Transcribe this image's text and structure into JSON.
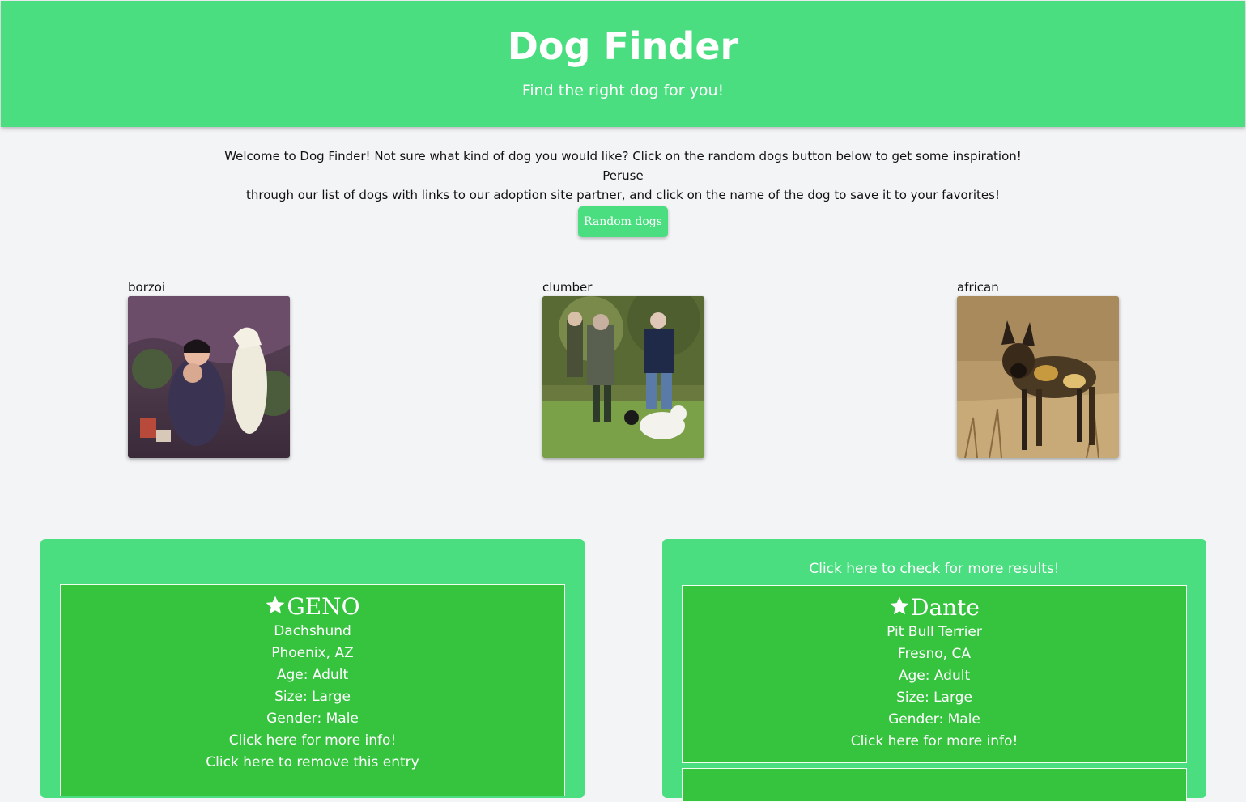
{
  "header": {
    "title": "Dog Finder",
    "subtitle": "Find the right dog for you!"
  },
  "intro": {
    "line1": "Welcome to Dog Finder! Not sure what kind of dog you would like? Click on the random dogs button below to get some inspiration! Peruse",
    "line2": "through our list of dogs with links to our adoption site partner, and click on the name of the dog to save it to your favorites!"
  },
  "random_button": {
    "label": "Random dogs"
  },
  "random_dogs": [
    {
      "breed": "borzoi"
    },
    {
      "breed": "clumber"
    },
    {
      "breed": "african"
    }
  ],
  "results_panel": {
    "more_results_link": "Click here to check for more results!"
  },
  "favorites": [
    {
      "name": "GENO",
      "breed": "Dachshund",
      "location": "Phoenix, AZ",
      "age": "Age: Adult",
      "size": "Size: Large",
      "gender": "Gender: Male",
      "more_info": "Click here for more info!",
      "remove": "Click here to remove this entry"
    }
  ],
  "results": [
    {
      "name": "Dante",
      "breed": "Pit Bull Terrier",
      "location": "Fresno, CA",
      "age": "Age: Adult",
      "size": "Size: Large",
      "gender": "Gender: Male",
      "more_info": "Click here for more info!"
    }
  ],
  "colors": {
    "header_green": "#4ade80",
    "card_green": "#36c43f",
    "background": "#f3f4f6"
  }
}
